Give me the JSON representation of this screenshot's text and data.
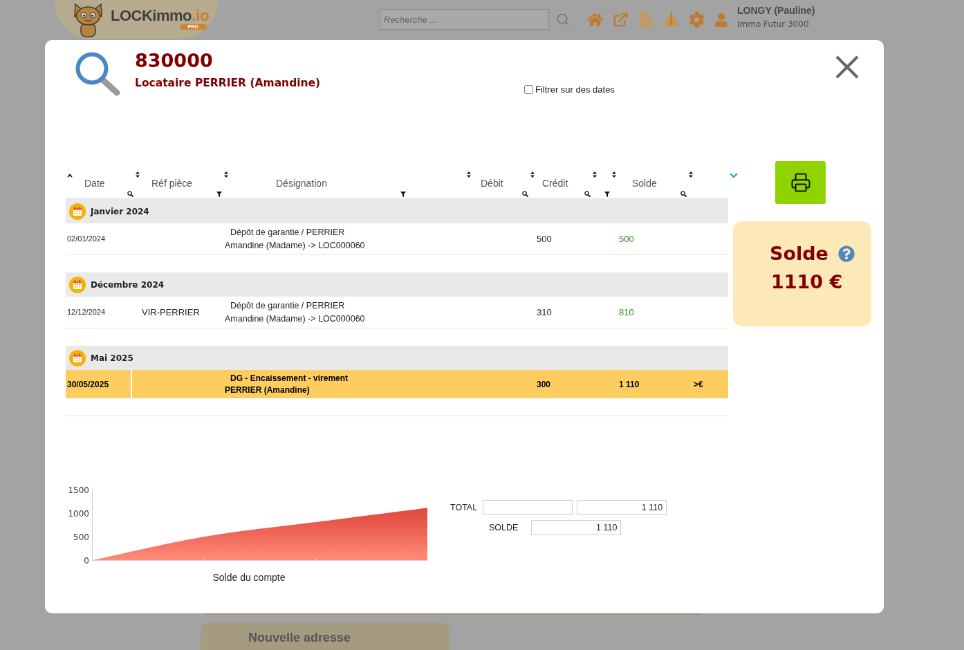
{
  "app_header": {
    "logo": {
      "name": "LOCKimmo",
      "domain": ".io",
      "badge": "PRO"
    },
    "search": {
      "placeholder": "Recherche ..."
    },
    "user": {
      "name": "LONGY (Pauline)",
      "agency": "Immo Futur 3000"
    }
  },
  "background_card": {
    "title": "Nouvelle adresse"
  },
  "dialog": {
    "code": "830000",
    "subtitle": "Locataire PERRIER (Amandine)",
    "date_filter": {
      "label": "Filtrer sur des dates",
      "checked": false
    },
    "table": {
      "columns": [
        {
          "label": "Date",
          "sorted": true,
          "sortable": true,
          "searchable": true,
          "filterable": false
        },
        {
          "label": "Réf pièce",
          "sorted": false,
          "sortable": true,
          "searchable": false,
          "filterable": true
        },
        {
          "label": "Désignation",
          "sorted": false,
          "sortable": false,
          "searchable": false,
          "filterable": true
        },
        {
          "sorted": false,
          "sortable": true,
          "searchable": false,
          "filterable": false
        },
        {
          "label": "Débit",
          "sorted": false,
          "sortable": true,
          "searchable": true,
          "filterable": false
        },
        {
          "label": "Crédit",
          "sorted": false,
          "sortable": true,
          "searchable": true,
          "filterable": false
        },
        {
          "sorted": false,
          "sortable": true,
          "searchable": false,
          "filterable": true
        },
        {
          "label": "Solde",
          "sorted": false,
          "sortable": true,
          "searchable": true,
          "filterable": false
        }
      ],
      "groups": [
        {
          "label": "Janvier 2024",
          "rows": [
            {
              "date": "02/01/2024",
              "designation": "Dépôt de garantie / PERRIER Amandine (Madame) -> LOC000060",
              "credit": "500",
              "solde": "500",
              "selected": false
            }
          ]
        },
        {
          "label": "Décembre 2024",
          "rows": [
            {
              "date": "12/12/2024",
              "ref": "VIR-PERRIER",
              "designation": "Dépôt de garantie / PERRIER Amandine (Madame) -> LOC000060",
              "credit": "310",
              "solde": "810",
              "selected": false
            }
          ]
        },
        {
          "label": "Mai 2025",
          "rows": [
            {
              "date": "30/05/2025",
              "designation": "DG - Encaissement - virement PERRIER (Amandine)",
              "credit": "300",
              "solde": "1 110",
              "column_6": ">€",
              "selected": true
            }
          ]
        }
      ]
    },
    "balance_card": {
      "label": "Solde",
      "value": "1110 €"
    },
    "chart": {
      "chart_data": {
        "type": "area",
        "xlabel": "Solde du compte",
        "values": [
          0,
          500,
          810,
          1110
        ],
        "ylim": [
          0,
          1500
        ],
        "yticks": [
          0,
          500,
          1000,
          1500
        ]
      }
    },
    "totals": [
      {
        "kind": "total",
        "label": "TOTAL",
        "value": "1 110"
      },
      {
        "kind": "balance",
        "label": "SOLDE",
        "value": "1 110"
      }
    ]
  }
}
